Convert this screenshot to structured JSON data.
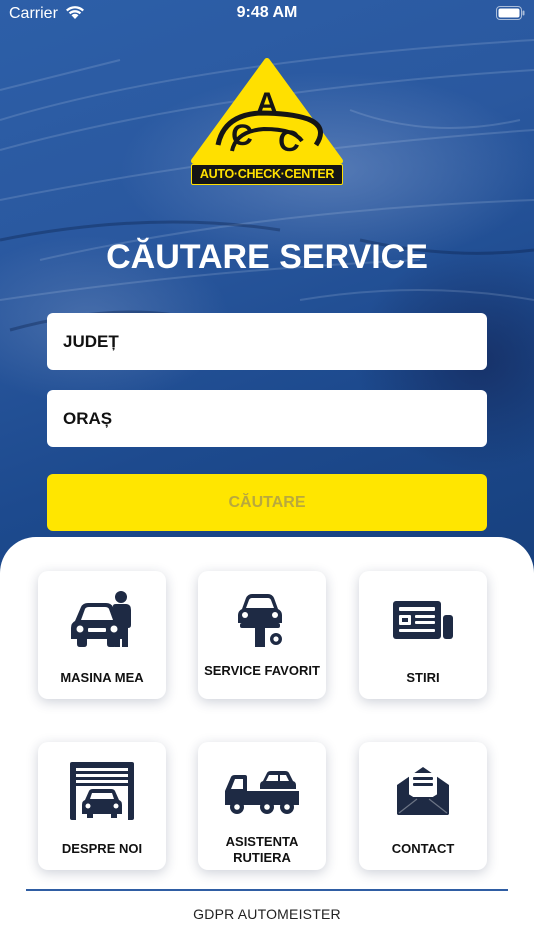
{
  "status_bar": {
    "carrier": "Carrier",
    "time": "9:48 AM"
  },
  "logo": {
    "letter_top": "A",
    "letter_left": "C",
    "letter_right": "C",
    "brand_text": "AUTO·CHECK·CENTER"
  },
  "page_title": "CĂUTARE SERVICE",
  "form": {
    "county_placeholder": "JUDEȚ",
    "city_placeholder": "ORAȘ",
    "search_label": "CĂUTARE"
  },
  "tiles": [
    {
      "label": "MASINA MEA",
      "icon": "car-person-icon"
    },
    {
      "label": "SERVICE FAVORIT",
      "icon": "car-lift-icon"
    },
    {
      "label": "STIRI",
      "icon": "newspaper-icon"
    },
    {
      "label": "DESPRE NOI",
      "icon": "garage-icon"
    },
    {
      "label": "ASISTENTA RUTIERA",
      "icon": "tow-truck-icon"
    },
    {
      "label": "CONTACT",
      "icon": "envelope-icon"
    }
  ],
  "footer": {
    "gdpr_link": "GDPR AUTOMEISTER"
  },
  "colors": {
    "brand_yellow": "#ffe600",
    "brand_blue": "#1b4a8e",
    "icon_navy": "#1e2a44"
  }
}
